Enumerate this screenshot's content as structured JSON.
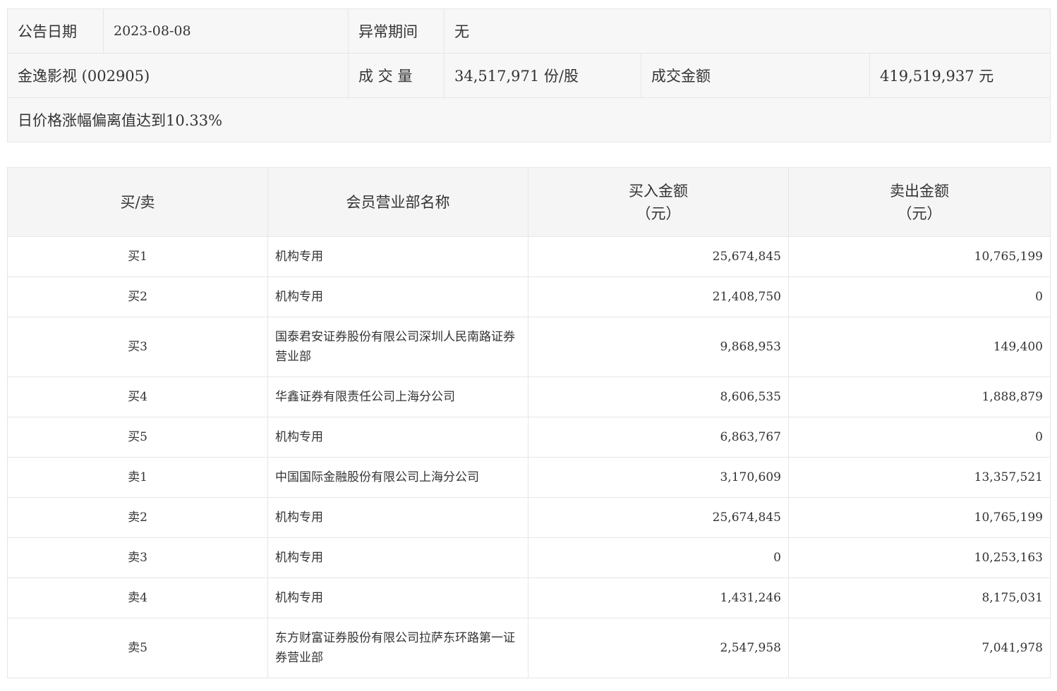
{
  "info": {
    "announce_date_label": "公告日期",
    "announce_date_value": "2023-08-08",
    "abnormal_period_label": "异常期间",
    "abnormal_period_value": "无",
    "stock_name": "金逸影视 (002905)",
    "volume_label": "成 交 量",
    "volume_value": "34,517,971 份/股",
    "turnover_label": "成交金额",
    "turnover_value": "419,519,937 元",
    "reason": "日价格涨幅偏离值达到10.33%"
  },
  "table": {
    "headers": {
      "side": "买/卖",
      "member": "会员营业部名称",
      "buy_line1": "买入金额",
      "buy_line2": "（元）",
      "sell_line1": "卖出金额",
      "sell_line2": "（元）"
    },
    "rows": [
      {
        "side": "买1",
        "member": "机构专用",
        "buy": "25,674,845",
        "sell": "10,765,199"
      },
      {
        "side": "买2",
        "member": "机构专用",
        "buy": "21,408,750",
        "sell": "0"
      },
      {
        "side": "买3",
        "member": "国泰君安证券股份有限公司深圳人民南路证券营业部",
        "buy": "9,868,953",
        "sell": "149,400"
      },
      {
        "side": "买4",
        "member": "华鑫证券有限责任公司上海分公司",
        "buy": "8,606,535",
        "sell": "1,888,879"
      },
      {
        "side": "买5",
        "member": "机构专用",
        "buy": "6,863,767",
        "sell": "0"
      },
      {
        "side": "卖1",
        "member": "中国国际金融股份有限公司上海分公司",
        "buy": "3,170,609",
        "sell": "13,357,521"
      },
      {
        "side": "卖2",
        "member": "机构专用",
        "buy": "25,674,845",
        "sell": "10,765,199"
      },
      {
        "side": "卖3",
        "member": "机构专用",
        "buy": "0",
        "sell": "10,253,163"
      },
      {
        "side": "卖4",
        "member": "机构专用",
        "buy": "1,431,246",
        "sell": "8,175,031"
      },
      {
        "side": "卖5",
        "member": "东方财富证券股份有限公司拉萨东环路第一证券营业部",
        "buy": "2,547,958",
        "sell": "7,041,978"
      }
    ]
  }
}
